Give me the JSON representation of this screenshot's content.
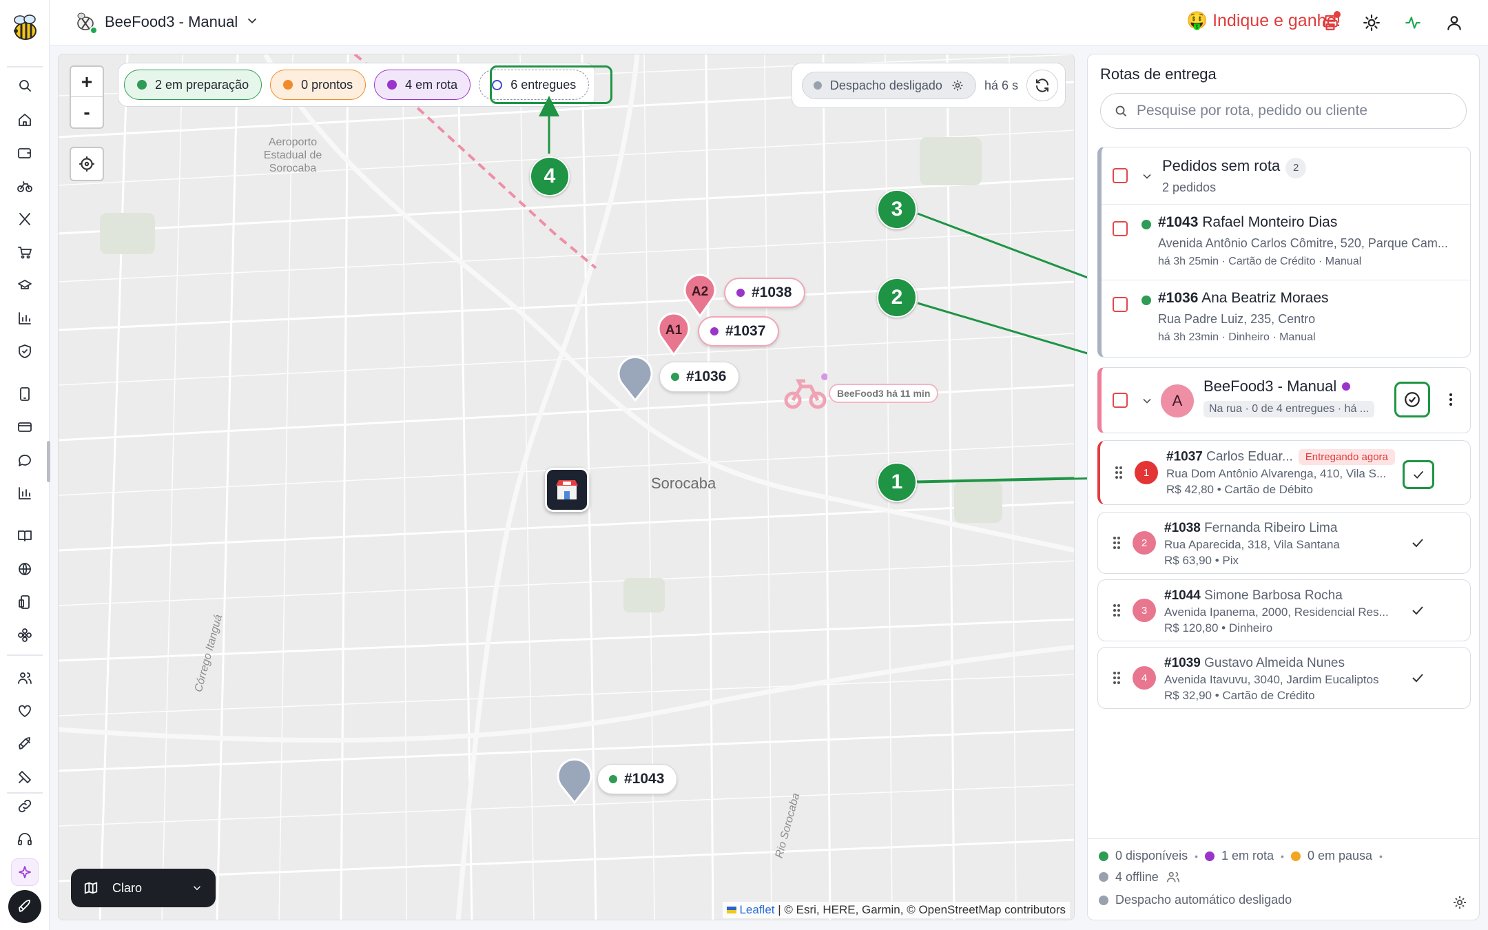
{
  "topbar": {
    "store_name": "BeeFood3 - Manual",
    "promo": "🤑 Indique e ganhe!"
  },
  "map": {
    "filters": [
      {
        "label": "2 em preparação",
        "color": "#2e9c55"
      },
      {
        "label": "0 prontos",
        "color": "#f08a2a"
      },
      {
        "label": "4 em rota",
        "color": "#9b35c9"
      },
      {
        "label": "6 entregues",
        "color": "#3b4ad1"
      }
    ],
    "dispatch_label": "Despacho desligado",
    "updated_ago": "há 6 s",
    "zoom_in": "+",
    "zoom_out": "-",
    "place_airport": "Aeroporto Estadual de Sorocaba",
    "city": "Sorocaba",
    "road_1": "Córrego Itanguá",
    "road_2": "Rio Sorocaba",
    "pins": {
      "a2": "A2",
      "a1": "A1",
      "o1038": "#1038",
      "o1037": "#1037",
      "o1036": "#1036",
      "o1043": "#1043"
    },
    "courier_label": "BeeFood3 há 11 min",
    "theme_label": "Claro",
    "attribution_link": "Leaflet",
    "attribution_text": " | © Esri, HERE, Garmin, © OpenStreetMap contributors",
    "steps": [
      "1",
      "2",
      "3",
      "4"
    ]
  },
  "panel": {
    "title": "Rotas de entrega",
    "search_placeholder": "Pesquise por rota, pedido ou cliente",
    "unrouted": {
      "title": "Pedidos sem rota",
      "count": "2",
      "subtitle": "2 pedidos",
      "orders": [
        {
          "id": "#1043",
          "name": "Rafael Monteiro Dias",
          "address": "Avenida Antônio Carlos Cômitre, 520, Parque Cam...",
          "meta": "há 3h 25min · Cartão de Crédito · Manual"
        },
        {
          "id": "#1036",
          "name": "Ana Beatriz Moraes",
          "address": "Rua Padre Luiz, 235, Centro",
          "meta": "há 3h 23min · Dinheiro · Manual"
        }
      ]
    },
    "route": {
      "avatar": "A",
      "name": "BeeFood3 - Manual",
      "status": "Na rua · 0 de 4 entregues · há ...",
      "stops": [
        {
          "n": "1",
          "id": "#1037",
          "name": "Carlos Eduar...",
          "badge": "Entregando agora",
          "address": "Rua Dom Antônio Alvarenga, 410, Vila S...",
          "meta": "R$ 42,80 • Cartão de Débito"
        },
        {
          "n": "2",
          "id": "#1038",
          "name": "Fernanda Ribeiro Lima",
          "address": "Rua Aparecida, 318, Vila Santana",
          "meta": "R$ 63,90 • Pix"
        },
        {
          "n": "3",
          "id": "#1044",
          "name": "Simone Barbosa Rocha",
          "address": "Avenida Ipanema, 2000, Residencial Res...",
          "meta": "R$ 120,80 • Dinheiro"
        },
        {
          "n": "4",
          "id": "#1039",
          "name": "Gustavo Almeida Nunes",
          "address": "Avenida Itavuvu, 3040, Jardim Eucaliptos",
          "meta": "R$ 32,90 • Cartão de Crédito"
        }
      ]
    },
    "footer": {
      "available": "0 disponíveis",
      "on_route": "1 em rota",
      "paused": "0 em pausa",
      "offline": "4 offline",
      "auto_dispatch": "Despacho automático desligado"
    }
  }
}
